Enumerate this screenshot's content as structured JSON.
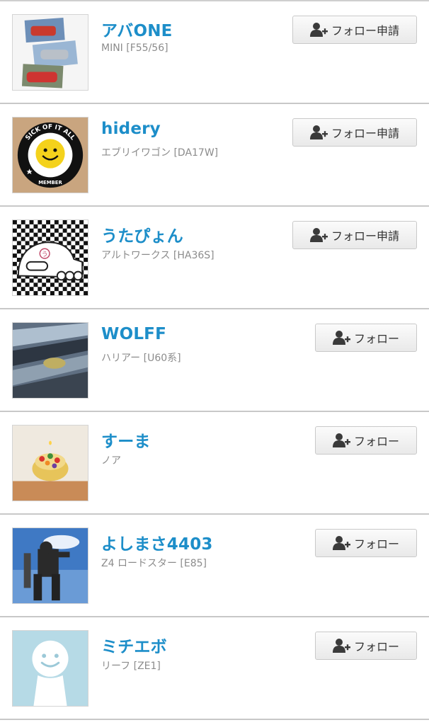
{
  "users": [
    {
      "name": "アバONE",
      "car": "MINI [F55/56]",
      "button": "フォロー申請",
      "button_type": "request",
      "avatar": "red-cars-collage"
    },
    {
      "name": "hidery",
      "car": "エブリイワゴン [DA17W]",
      "button": "フォロー申請",
      "button_type": "request",
      "avatar": "smiley-badge",
      "avatar_text": [
        "SICK OF IT ALL",
        "MEMBER"
      ]
    },
    {
      "name": "うたぴょん",
      "car": "アルトワークス [HA36S]",
      "button": "フォロー申請",
      "button_type": "request",
      "avatar": "checkered-car-cartoon",
      "avatar_text": [
        "う"
      ]
    },
    {
      "name": "WOLFF",
      "car": "ハリアー [U60系]",
      "button": "フォロー",
      "button_type": "plain",
      "avatar": "car-grille-photo"
    },
    {
      "name": "すーま",
      "car": "ノア",
      "button": "フォロー",
      "button_type": "plain",
      "avatar": "fruit-tart-photo"
    },
    {
      "name": "よしまさ4403",
      "car": "Z4 ロードスター [E85]",
      "button": "フォロー",
      "button_type": "plain",
      "avatar": "robot-statue-photo"
    },
    {
      "name": "ミチエボ",
      "car": "リーフ [ZE1]",
      "button": "フォロー",
      "button_type": "plain",
      "avatar": "default-avatar"
    }
  ],
  "icons": {
    "follow": "person-add-icon"
  },
  "colors": {
    "name": "#1d8ec9",
    "car": "#8c8c8c",
    "button_text": "#333333"
  }
}
